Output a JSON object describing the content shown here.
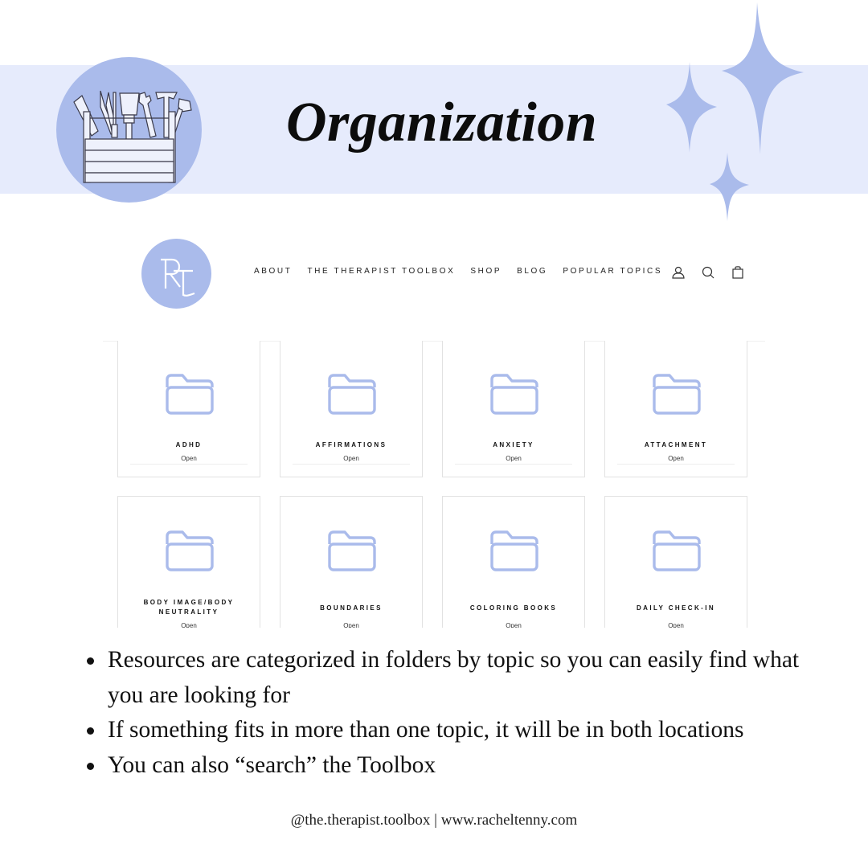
{
  "slide": {
    "title": "Organization",
    "colors": {
      "band": "#e6ebfc",
      "accent": "#aabbeb",
      "text": "#111111"
    },
    "badge_icon": "toolbox-icon",
    "decoration_icon": "sparkles-icon"
  },
  "website": {
    "logo_text": "RT",
    "nav": [
      {
        "label": "ABOUT"
      },
      {
        "label": "THE THERAPIST TOOLBOX"
      },
      {
        "label": "SHOP"
      },
      {
        "label": "BLOG"
      },
      {
        "label": "POPULAR TOPICS"
      }
    ],
    "icons": [
      "account-icon",
      "search-icon",
      "cart-icon"
    ],
    "folders": [
      {
        "label": "ADHD",
        "action": "Open"
      },
      {
        "label": "AFFIRMATIONS",
        "action": "Open"
      },
      {
        "label": "ANXIETY",
        "action": "Open"
      },
      {
        "label": "ATTACHMENT",
        "action": "Open"
      },
      {
        "label": "BODY IMAGE/BODY NEUTRALITY",
        "line1": "BODY IMAGE/BODY",
        "line2": "NEUTRALITY",
        "action": "Open"
      },
      {
        "label": "BOUNDARIES",
        "action": "Open"
      },
      {
        "label": "COLORING BOOKS",
        "action": "Open"
      },
      {
        "label": "DAILY CHECK-IN",
        "action": "Open"
      }
    ]
  },
  "bullets": [
    "Resources are categorized in folders by topic so you can easily find what you are looking for",
    "If something fits in more than one topic, it will be in both locations",
    "You can also “search” the Toolbox"
  ],
  "footer": "@the.therapist.toolbox | www.racheltenny.com"
}
